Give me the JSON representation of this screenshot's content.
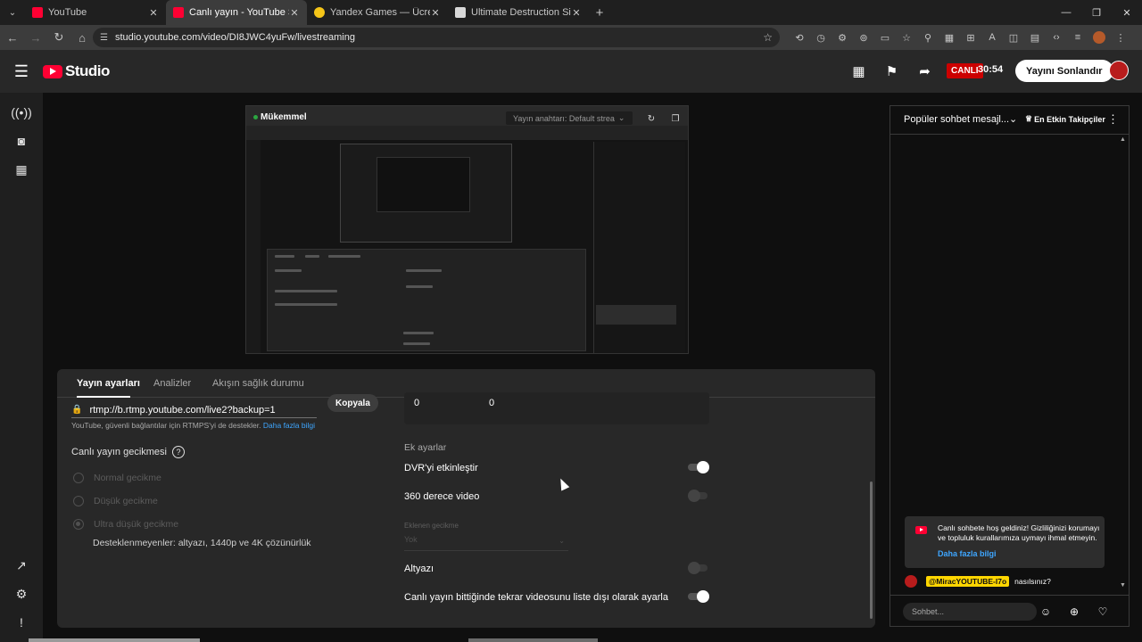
{
  "browser": {
    "tabs": [
      {
        "title": "YouTube",
        "favicon": "youtube-icon",
        "active": false
      },
      {
        "title": "Canlı yayın - YouTube Studio",
        "favicon": "youtube-icon",
        "active": true
      },
      {
        "title": "Yandex Games — Ücretsiz ve hı",
        "favicon": "yandex-icon",
        "active": false
      },
      {
        "title": "Ultimate Destruction Simulator",
        "favicon": "game-icon",
        "active": false
      }
    ],
    "url": "studio.youtube.com/video/DI8JWC4yuFw/livestreaming"
  },
  "header": {
    "logo_text": "Studio",
    "live_badge": "CANLI",
    "live_time": "30:54",
    "end_button": "Yayını Sonlandır"
  },
  "preview": {
    "status": "Mükemmel",
    "stream_key_label": "Yayın anahtarı: Default strea"
  },
  "settings": {
    "tabs": [
      "Yayın ayarları",
      "Analizler",
      "Akışın sağlık durumu"
    ],
    "backup_url": "rtmp://b.rtmp.youtube.com/live2?backup=1",
    "copy_button": "Kopyala",
    "rtmps_help": "YouTube, güvenli bağlantılar için RTMPS'yi de destekler.",
    "rtmps_help_link": "Daha fazla bilgi",
    "latency_title": "Canlı yayın gecikmesi",
    "latency_options": [
      "Normal gecikme",
      "Düşük gecikme",
      "Ultra düşük gecikme"
    ],
    "latency_selected": "Ultra düşük gecikme",
    "unsupported_note": "Desteklenmeyenler: altyazı, 1440p ve 4K çözünürlük",
    "stat_values": [
      "0",
      "0"
    ],
    "extra_title": "Ek ayarlar",
    "dvr_label": "DVR'yi etkinleştir",
    "dvr_on": true,
    "video360_label": "360 derece video",
    "video360_on": false,
    "delay_label": "Eklenen gecikme",
    "delay_value": "Yok",
    "captions_label": "Altyazı",
    "captions_on": false,
    "unlist_label": "Canlı yayın bittiğinde tekrar videosunu liste dışı olarak ayarla",
    "unlist_on": true
  },
  "chat": {
    "mode": "Popüler sohbet mesajl...",
    "top_fans": "En Etkin Takipçiler",
    "welcome_text": "Canlı sohbete hoş geldiniz! Gizliliğinizi korumayı ve topluluk kurallarımıza uymayı ihmal etmeyin.",
    "welcome_link": "Daha fazla bilgi",
    "messages": [
      {
        "author": "@MiracYOUTUBE-l7o",
        "text": "nasılsınız?"
      }
    ],
    "input_placeholder": "Sohbet..."
  },
  "colors": {
    "accent_red": "#ff0033",
    "live_red": "#cc0000",
    "link_blue": "#3ea6ff",
    "owner_badge": "#ffd600"
  }
}
